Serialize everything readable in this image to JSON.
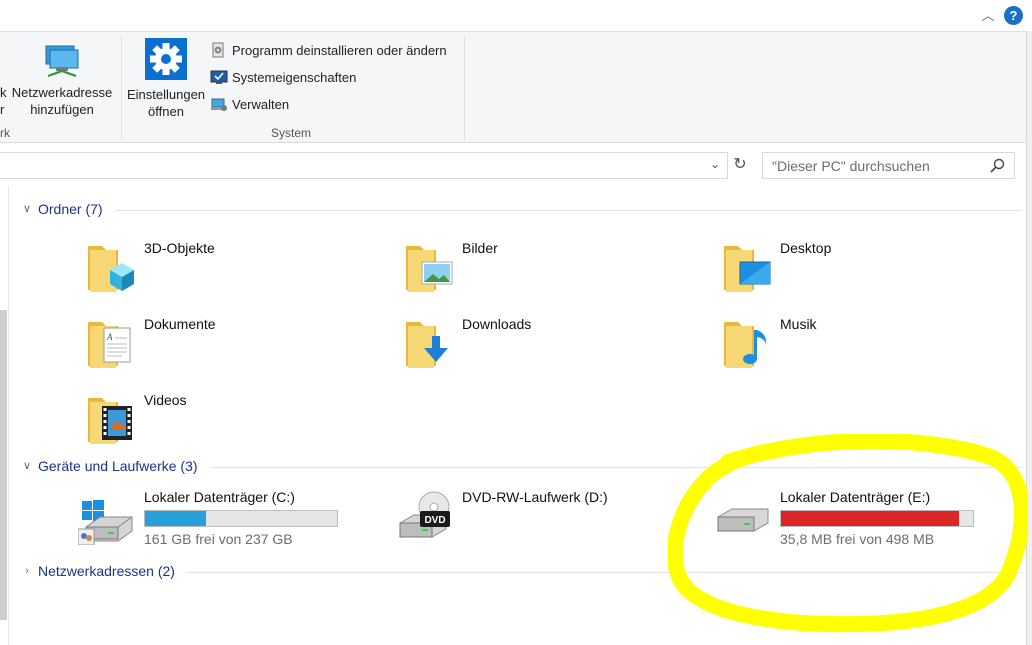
{
  "window": {
    "help_label": "?",
    "collapse_glyph": "︿"
  },
  "ribbon": {
    "partial_left_label": "k",
    "partial_left_sub": "r",
    "add_network_label_1": "Netzwerkadresse",
    "add_network_label_2": "hinzufügen",
    "network_group_partial": "rk",
    "settings_label_1": "Einstellungen",
    "settings_label_2": "öffnen",
    "uninstall_label": "Programm deinstallieren oder ändern",
    "system_props_label": "Systemeigenschaften",
    "manage_label": "Verwalten",
    "system_group_label": "System"
  },
  "address": {
    "chevron": "⌄",
    "refresh": "↻",
    "search_placeholder": "\"Dieser PC\" durchsuchen"
  },
  "sections": {
    "folders": {
      "header": "Ordner (7)"
    },
    "devices": {
      "header": "Geräte und Laufwerke (3)"
    },
    "network": {
      "header": "Netzwerkadressen (2)"
    }
  },
  "folders": [
    {
      "label": "3D-Objekte",
      "icon": "3d-objects-folder-icon"
    },
    {
      "label": "Bilder",
      "icon": "pictures-folder-icon"
    },
    {
      "label": "Desktop",
      "icon": "desktop-folder-icon"
    },
    {
      "label": "Dokumente",
      "icon": "documents-folder-icon"
    },
    {
      "label": "Downloads",
      "icon": "downloads-folder-icon"
    },
    {
      "label": "Musik",
      "icon": "music-folder-icon"
    },
    {
      "label": "Videos",
      "icon": "videos-folder-icon"
    }
  ],
  "drives": [
    {
      "name": "Lokaler Datenträger (C:)",
      "free": "161 GB frei von 237 GB",
      "used_fraction": 0.32,
      "bar_color": "#26a0da"
    },
    {
      "name": "DVD-RW-Laufwerk (D:)",
      "dvd_label": "DVD"
    },
    {
      "name": "Lokaler Datenträger (E:)",
      "free": "35,8 MB frei von 498 MB",
      "used_fraction": 0.928,
      "bar_color": "#da2626"
    }
  ],
  "colors": {
    "accent": "#1e3287",
    "highlight": "#ffff00"
  }
}
